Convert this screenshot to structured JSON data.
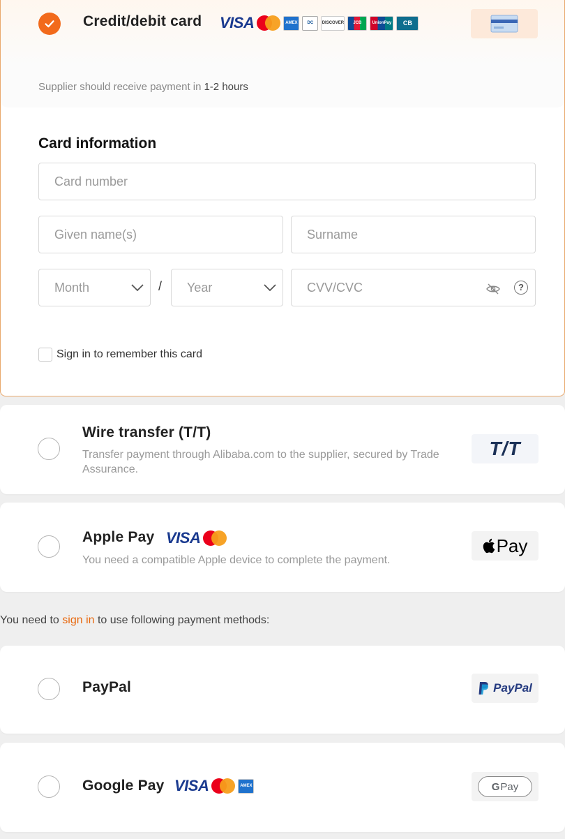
{
  "credit_card": {
    "title": "Credit/debit card",
    "brands": [
      "VISA",
      "mastercard",
      "amex",
      "diners",
      "DISCOVER",
      "JCB",
      "UnionPay",
      "CB"
    ],
    "hint_label": "Supplier should receive payment in",
    "hint_value": "1-2 hours",
    "selected": true,
    "icon": "credit-card-icon"
  },
  "card_form": {
    "title": "Card information",
    "card_number_placeholder": "Card number",
    "given_name_placeholder": "Given name(s)",
    "surname_placeholder": "Surname",
    "month_placeholder": "Month",
    "separator": "/",
    "year_placeholder": "Year",
    "cvv_placeholder": "CVV/CVC",
    "help_icon": "?",
    "remember_label": "Sign in to remember this card"
  },
  "wire_transfer": {
    "title": "Wire transfer (T/T)",
    "description": "Transfer payment through Alibaba.com to the supplier, secured by Trade Assurance.",
    "logo_text": "T/T"
  },
  "apple_pay": {
    "title": "Apple Pay",
    "brands": [
      "VISA",
      "mastercard"
    ],
    "description": "You need a compatible Apple device to complete the payment.",
    "logo_text": "Pay"
  },
  "signin_note": {
    "before": "You need to ",
    "link": "sign in",
    "after": " to use following payment methods:"
  },
  "paypal": {
    "title": "PayPal",
    "logo_text": "PayPal"
  },
  "google_pay": {
    "title": "Google Pay",
    "brands": [
      "VISA",
      "mastercard",
      "amex"
    ],
    "logo_text": "Pay"
  },
  "colors": {
    "accent": "#f26a1b",
    "visa_blue": "#1a3a8f",
    "link": "#e8690f"
  }
}
